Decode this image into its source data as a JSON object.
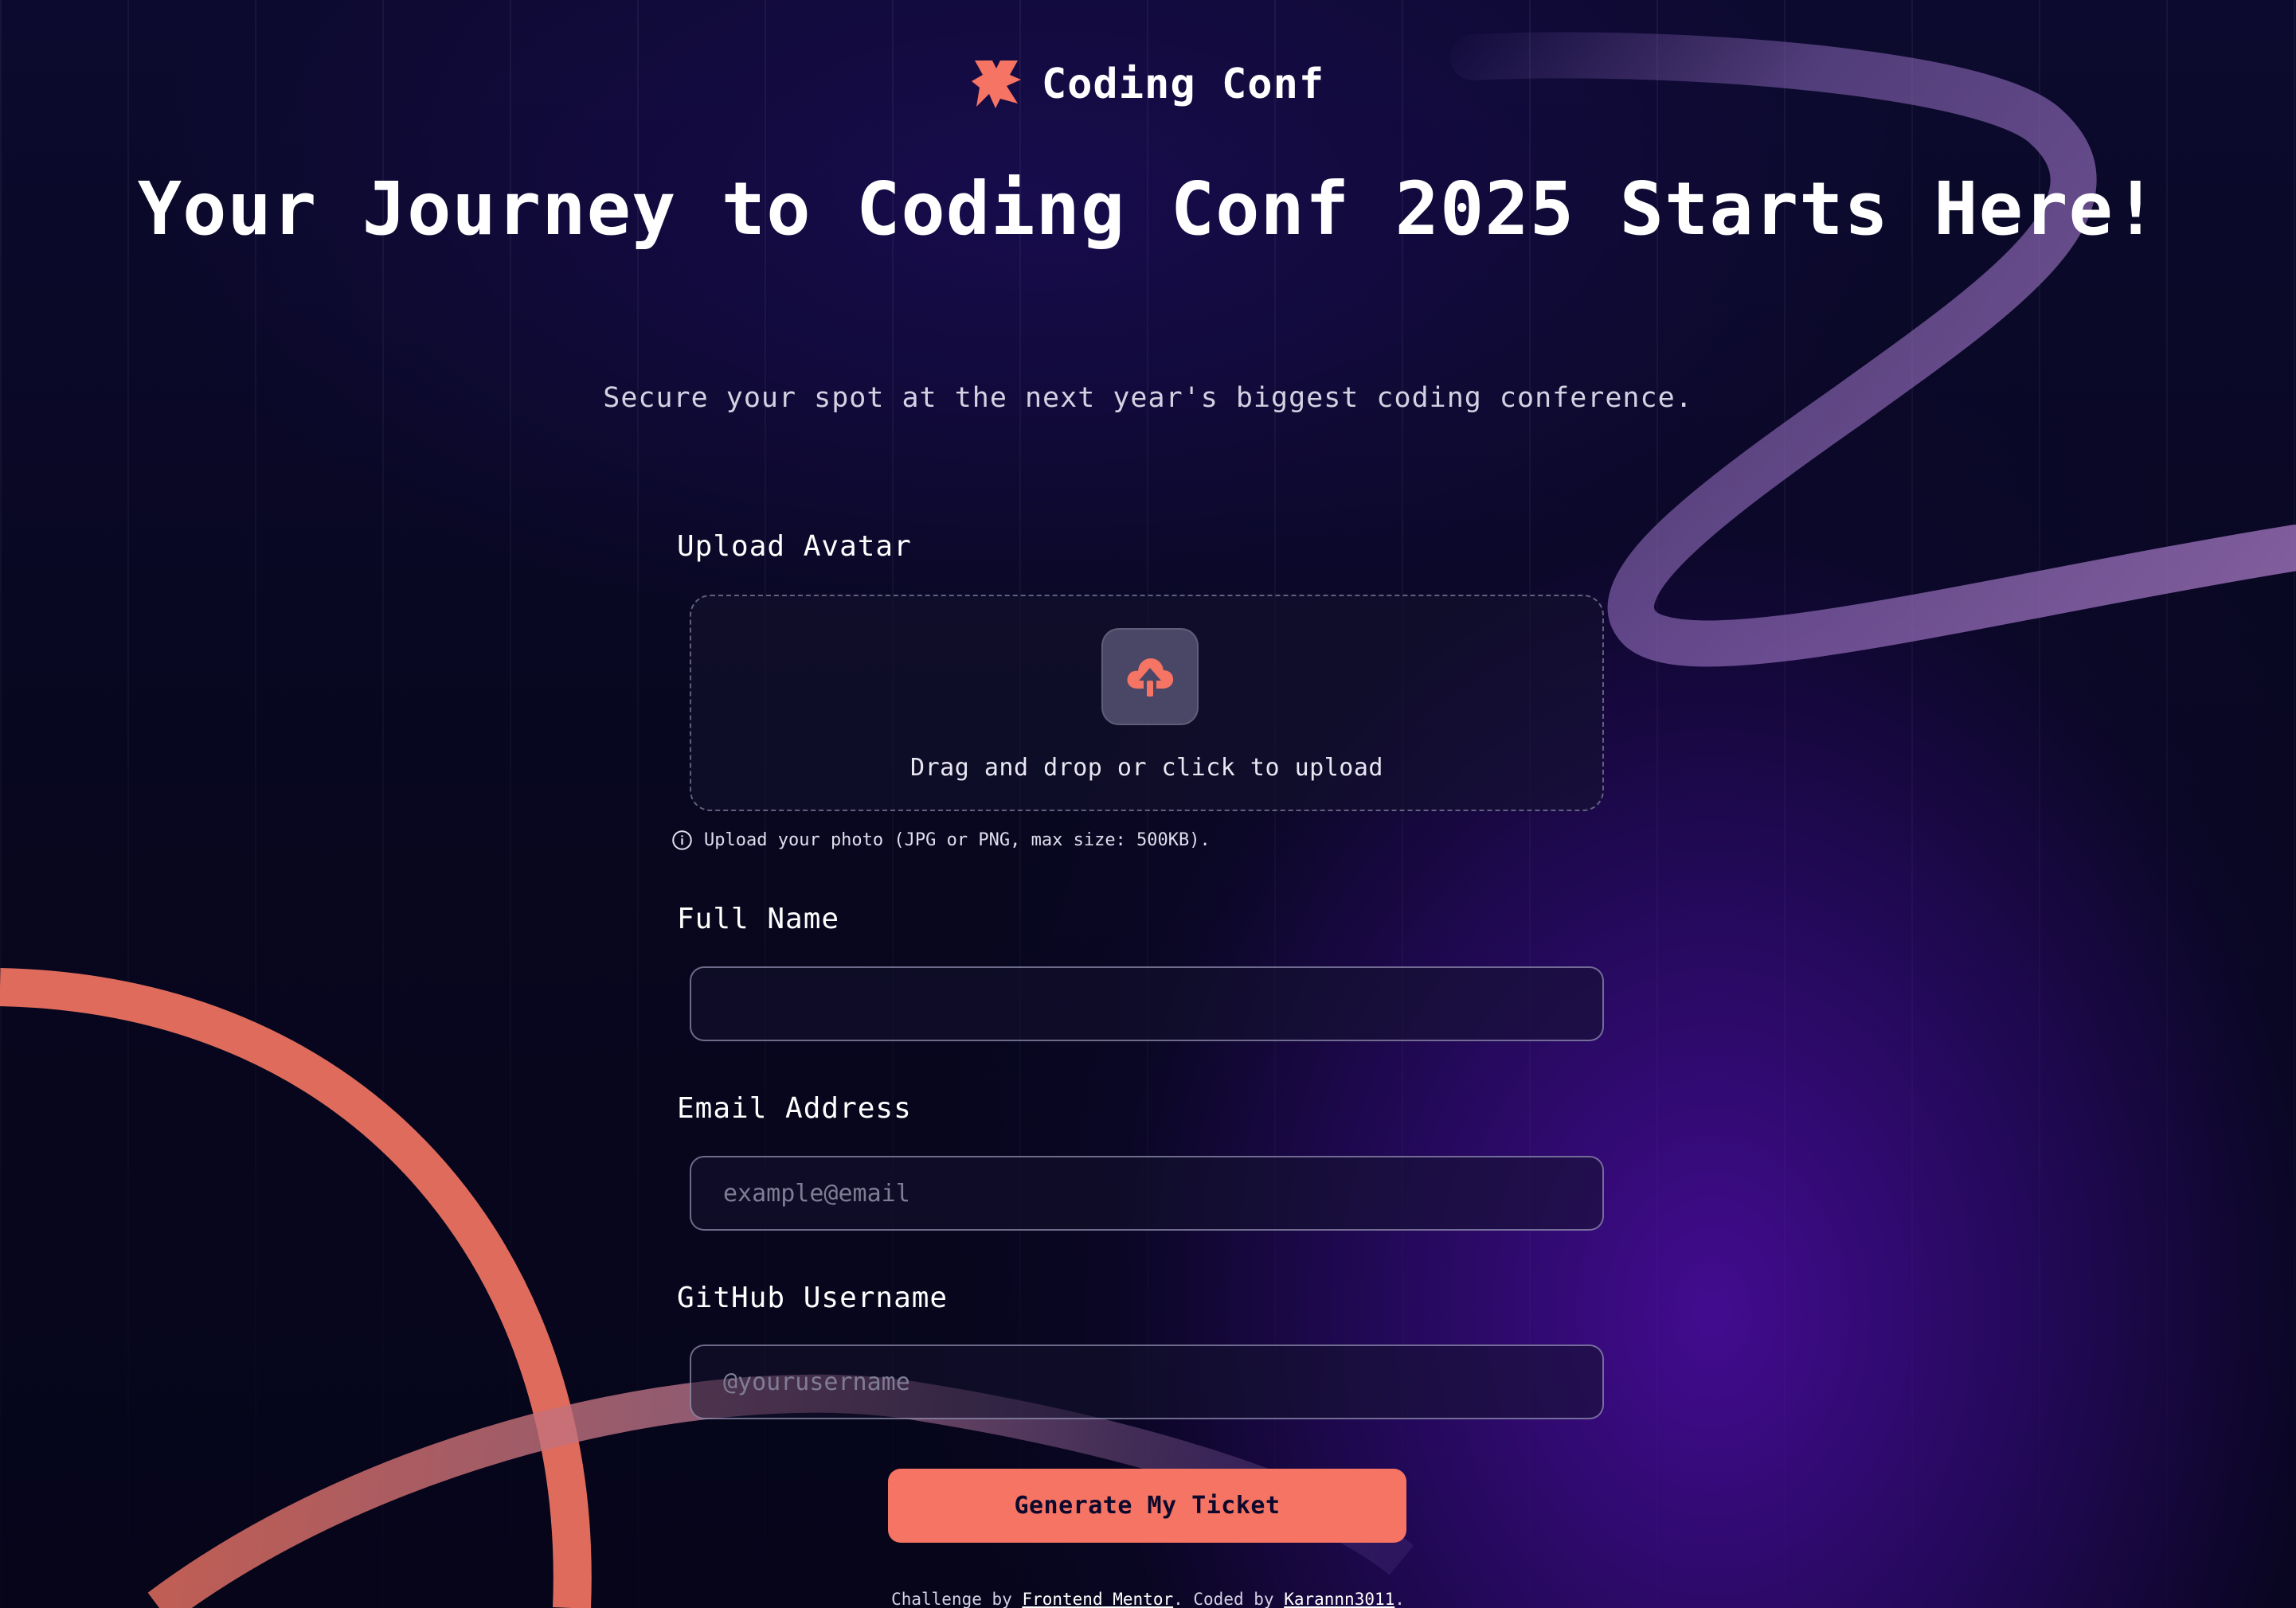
{
  "colors": {
    "accent": "#f57463",
    "background": "#0d082d",
    "purple_glow": "#3b0f8a",
    "line_coral": "#f47361",
    "line_lilac": "#8a67b8"
  },
  "header": {
    "logo_icon": "coding-conf-logo",
    "title": "Coding Conf"
  },
  "hero": {
    "title": "Your Journey to Coding Conf 2025 Starts Here!",
    "subtitle": "Secure your spot at the next year's biggest coding conference."
  },
  "form": {
    "avatar": {
      "label": "Upload Avatar",
      "dropzone_text": "Drag and drop or click to upload",
      "icon": "cloud-upload-icon",
      "hint": "Upload your photo (JPG or PNG, max size: 500KB).",
      "hint_icon": "info-icon"
    },
    "full_name": {
      "label": "Full Name",
      "value": "",
      "placeholder": ""
    },
    "email": {
      "label": "Email Address",
      "value": "",
      "placeholder": "example@email"
    },
    "github": {
      "label": "GitHub Username",
      "value": "",
      "placeholder": "@yourusername"
    },
    "submit_label": "Generate My Ticket"
  },
  "footer": {
    "prefix": "Challenge by ",
    "link1": "Frontend Mentor",
    "middle": ". Coded by ",
    "link2": "Karannn3011",
    "suffix": "."
  }
}
